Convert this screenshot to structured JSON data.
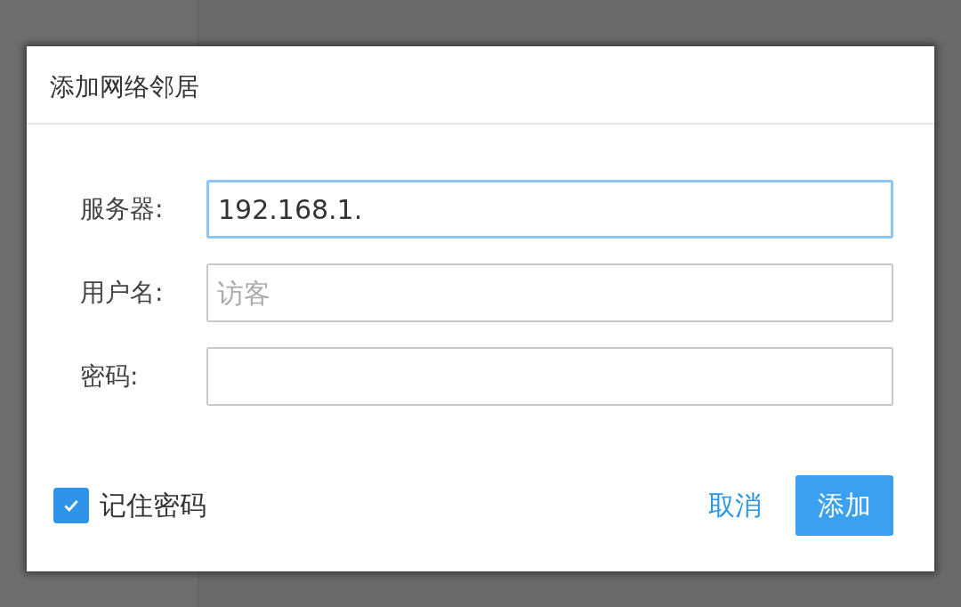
{
  "dialog": {
    "title": "添加网络邻居",
    "fields": [
      {
        "label": "服务器:",
        "value": "192.168.1.",
        "focused": true
      },
      {
        "label": "用户名:",
        "placeholder": "访客",
        "focused": false
      },
      {
        "label": "密码:",
        "focused": false
      }
    ],
    "remember": {
      "label": "记住密码",
      "checked": true
    },
    "buttons": [
      {
        "label": "取消",
        "kind": "text"
      },
      {
        "label": "添加",
        "kind": "primary"
      }
    ]
  }
}
